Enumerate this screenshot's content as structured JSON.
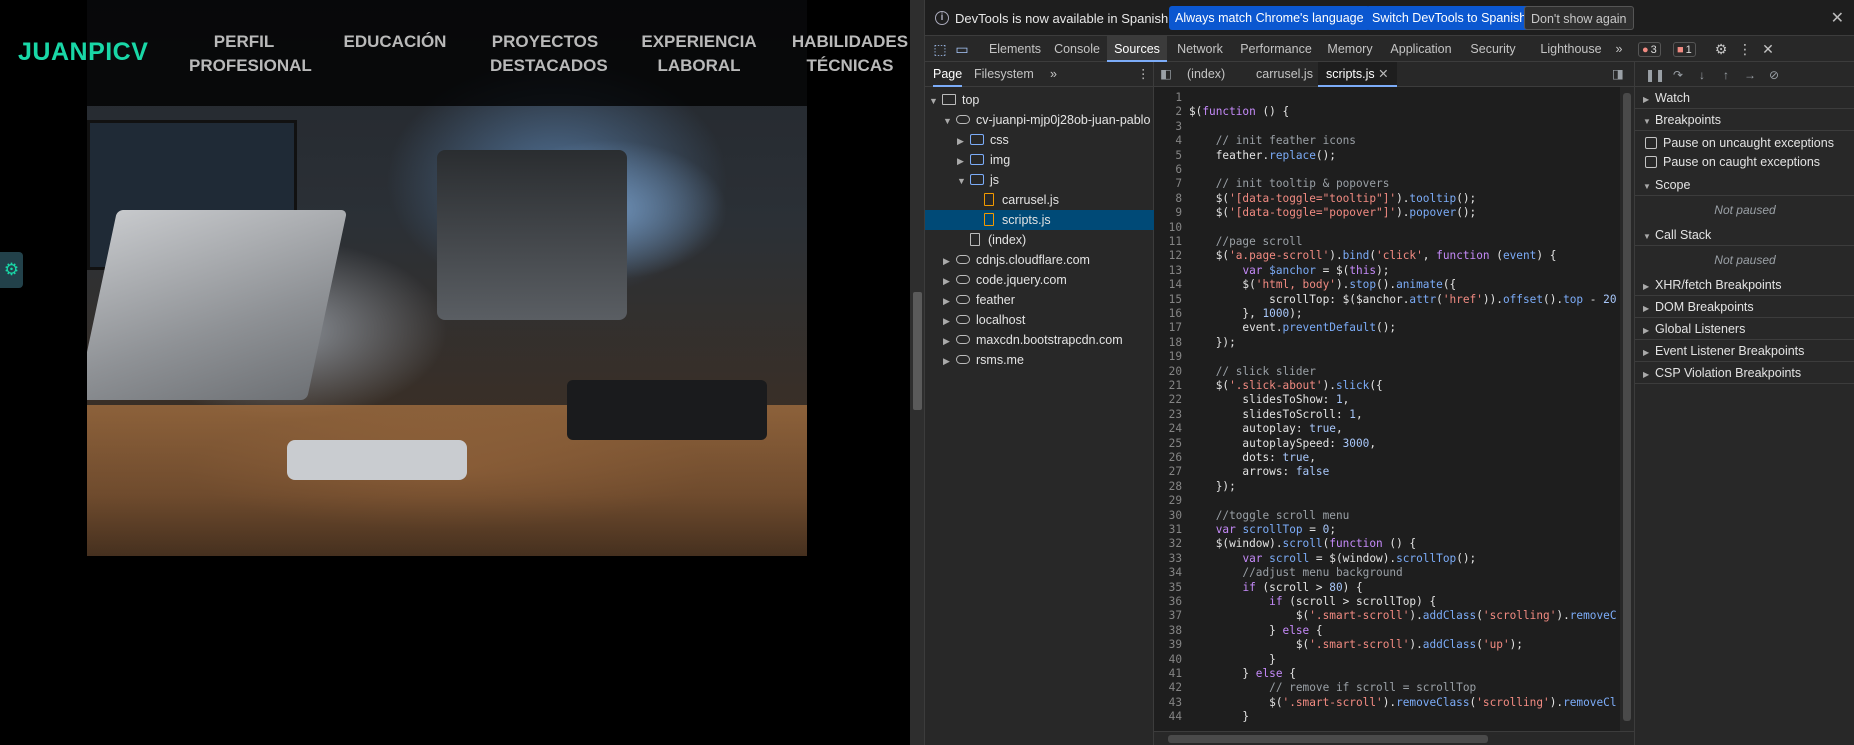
{
  "website": {
    "logo": "JUANPICV",
    "nav": [
      {
        "line1": "PERFIL",
        "line2": "PROFESIONAL"
      },
      {
        "line1": "EDUCACIÓN",
        "line2": ""
      },
      {
        "line1": "PROYECTOS",
        "line2": "DESTACADOS"
      },
      {
        "line1": "EXPERIENCIA",
        "line2": "LABORAL"
      },
      {
        "line1": "HABILIDADES",
        "line2": "TÉCNICAS"
      }
    ],
    "settings_icon": "⚙",
    "colors": {
      "accent": "#19d7a7",
      "nav_text": "#b9b9b9"
    }
  },
  "infobar": {
    "message": "DevTools is now available in Spanish!",
    "btn_match": "Always match Chrome's language",
    "btn_switch": "Switch DevTools to Spanish",
    "btn_dismiss": "Don't show again",
    "close": "✕"
  },
  "tabs": {
    "items": [
      "Elements",
      "Console",
      "Sources",
      "Network",
      "Performance",
      "Memory",
      "Application",
      "Security",
      "Lighthouse"
    ],
    "active": "Sources",
    "more": "»",
    "errors": "3",
    "warnings": "1"
  },
  "navigator": {
    "subtabs": [
      "Page",
      "Filesystem"
    ],
    "more": "»",
    "tree": [
      {
        "label": "top",
        "icon": "frame"
      },
      {
        "label": "cv-juanpi-mjp0j28ob-juan-pablo",
        "icon": "cloud"
      },
      {
        "label": "css",
        "icon": "folder"
      },
      {
        "label": "img",
        "icon": "folder"
      },
      {
        "label": "js",
        "icon": "folder"
      },
      {
        "label": "carrusel.js",
        "icon": "file-js"
      },
      {
        "label": "scripts.js",
        "icon": "file-js"
      },
      {
        "label": "(index)",
        "icon": "file"
      },
      {
        "label": "cdnjs.cloudflare.com",
        "icon": "cloud"
      },
      {
        "label": "code.jquery.com",
        "icon": "cloud"
      },
      {
        "label": "feather",
        "icon": "cloud"
      },
      {
        "label": "localhost",
        "icon": "cloud"
      },
      {
        "label": "maxcdn.bootstrapcdn.com",
        "icon": "cloud"
      },
      {
        "label": "rsms.me",
        "icon": "cloud"
      }
    ]
  },
  "editor": {
    "tabs": [
      "(index)",
      "carrusel.js",
      "scripts.js"
    ],
    "active_tab": "scripts.js",
    "lines": [
      [],
      [
        [
          "$(",
          "src"
        ],
        [
          "function",
          "c-kw"
        ],
        [
          " () {",
          "src"
        ]
      ],
      [],
      [
        [
          "    // init feather icons",
          "c-cmt"
        ]
      ],
      [
        [
          "    feather.",
          "src"
        ],
        [
          "replace",
          "c-fn"
        ],
        [
          "();",
          "src"
        ]
      ],
      [],
      [
        [
          "    // init tooltip & popovers",
          "c-cmt"
        ]
      ],
      [
        [
          "    $(",
          "src"
        ],
        [
          "'[data-toggle=\"tooltip\"]'",
          "c-str"
        ],
        [
          ").",
          "src"
        ],
        [
          "tooltip",
          "c-fn"
        ],
        [
          "();",
          "src"
        ]
      ],
      [
        [
          "    $(",
          "src"
        ],
        [
          "'[data-toggle=\"popover\"]'",
          "c-str"
        ],
        [
          ").",
          "src"
        ],
        [
          "popover",
          "c-fn"
        ],
        [
          "();",
          "src"
        ]
      ],
      [],
      [
        [
          "    //page scroll",
          "c-cmt"
        ]
      ],
      [
        [
          "    $(",
          "src"
        ],
        [
          "'a.page-scroll'",
          "c-str"
        ],
        [
          ").",
          "src"
        ],
        [
          "bind",
          "c-fn"
        ],
        [
          "(",
          "src"
        ],
        [
          "'click'",
          "c-str"
        ],
        [
          ", ",
          "src"
        ],
        [
          "function",
          "c-kw"
        ],
        [
          " (",
          "src"
        ],
        [
          "event",
          "c-var"
        ],
        [
          ") {",
          "src"
        ]
      ],
      [
        [
          "        ",
          "src"
        ],
        [
          "var",
          "c-kw"
        ],
        [
          " ",
          "src"
        ],
        [
          "$anchor",
          "c-var"
        ],
        [
          " = $(",
          "src"
        ],
        [
          "this",
          "c-kw"
        ],
        [
          ");",
          "src"
        ]
      ],
      [
        [
          "        $(",
          "src"
        ],
        [
          "'html, body'",
          "c-str"
        ],
        [
          ").",
          "src"
        ],
        [
          "stop",
          "c-fn"
        ],
        [
          "().",
          "src"
        ],
        [
          "animate",
          "c-fn"
        ],
        [
          "({",
          "src"
        ]
      ],
      [
        [
          "            scrollTop: $($anchor.",
          "src"
        ],
        [
          "attr",
          "c-fn"
        ],
        [
          "(",
          "src"
        ],
        [
          "'href'",
          "c-str"
        ],
        [
          ")).",
          "src"
        ],
        [
          "offset",
          "c-fn"
        ],
        [
          "().",
          "src"
        ],
        [
          "top",
          "c-var"
        ],
        [
          " - ",
          "src"
        ],
        [
          "20",
          "c-num"
        ]
      ],
      [
        [
          "        }, ",
          "src"
        ],
        [
          "1000",
          "c-num"
        ],
        [
          ");",
          "src"
        ]
      ],
      [
        [
          "        event.",
          "src"
        ],
        [
          "preventDefault",
          "c-fn"
        ],
        [
          "();",
          "src"
        ]
      ],
      [
        [
          "    });",
          "src"
        ]
      ],
      [],
      [
        [
          "    // slick slider",
          "c-cmt"
        ]
      ],
      [
        [
          "    $(",
          "src"
        ],
        [
          "'.slick-about'",
          "c-str"
        ],
        [
          ").",
          "src"
        ],
        [
          "slick",
          "c-fn"
        ],
        [
          "({",
          "src"
        ]
      ],
      [
        [
          "        slidesToShow: ",
          "src"
        ],
        [
          "1",
          "c-num"
        ],
        [
          ",",
          "src"
        ]
      ],
      [
        [
          "        slidesToScroll: ",
          "src"
        ],
        [
          "1",
          "c-num"
        ],
        [
          ",",
          "src"
        ]
      ],
      [
        [
          "        autoplay: ",
          "src"
        ],
        [
          "true",
          "c-lit"
        ],
        [
          ",",
          "src"
        ]
      ],
      [
        [
          "        autoplaySpeed: ",
          "src"
        ],
        [
          "3000",
          "c-num"
        ],
        [
          ",",
          "src"
        ]
      ],
      [
        [
          "        dots: ",
          "src"
        ],
        [
          "true",
          "c-lit"
        ],
        [
          ",",
          "src"
        ]
      ],
      [
        [
          "        arrows: ",
          "src"
        ],
        [
          "false",
          "c-lit"
        ]
      ],
      [
        [
          "    });",
          "src"
        ]
      ],
      [],
      [
        [
          "    //toggle scroll menu",
          "c-cmt"
        ]
      ],
      [
        [
          "    ",
          "src"
        ],
        [
          "var",
          "c-kw"
        ],
        [
          " ",
          "src"
        ],
        [
          "scrollTop",
          "c-var"
        ],
        [
          " = ",
          "src"
        ],
        [
          "0",
          "c-num"
        ],
        [
          ";",
          "src"
        ]
      ],
      [
        [
          "    $(window).",
          "src"
        ],
        [
          "scroll",
          "c-fn"
        ],
        [
          "(",
          "src"
        ],
        [
          "function",
          "c-kw"
        ],
        [
          " () {",
          "src"
        ]
      ],
      [
        [
          "        ",
          "src"
        ],
        [
          "var",
          "c-kw"
        ],
        [
          " ",
          "src"
        ],
        [
          "scroll",
          "c-var"
        ],
        [
          " = $(window).",
          "src"
        ],
        [
          "scrollTop",
          "c-fn"
        ],
        [
          "();",
          "src"
        ]
      ],
      [
        [
          "        //adjust menu background",
          "c-cmt"
        ]
      ],
      [
        [
          "        ",
          "src"
        ],
        [
          "if",
          "c-kw"
        ],
        [
          " (scroll > ",
          "src"
        ],
        [
          "80",
          "c-num"
        ],
        [
          ") {",
          "src"
        ]
      ],
      [
        [
          "            ",
          "src"
        ],
        [
          "if",
          "c-kw"
        ],
        [
          " (scroll > scrollTop) {",
          "src"
        ]
      ],
      [
        [
          "                $(",
          "src"
        ],
        [
          "'.smart-scroll'",
          "c-str"
        ],
        [
          ").",
          "src"
        ],
        [
          "addClass",
          "c-fn"
        ],
        [
          "(",
          "src"
        ],
        [
          "'scrolling'",
          "c-str"
        ],
        [
          ").",
          "src"
        ],
        [
          "removeC",
          "c-fn"
        ]
      ],
      [
        [
          "            } ",
          "src"
        ],
        [
          "else",
          "c-kw"
        ],
        [
          " {",
          "src"
        ]
      ],
      [
        [
          "                $(",
          "src"
        ],
        [
          "'.smart-scroll'",
          "c-str"
        ],
        [
          ").",
          "src"
        ],
        [
          "addClass",
          "c-fn"
        ],
        [
          "(",
          "src"
        ],
        [
          "'up'",
          "c-str"
        ],
        [
          ");",
          "src"
        ]
      ],
      [
        [
          "            }",
          "src"
        ]
      ],
      [
        [
          "        } ",
          "src"
        ],
        [
          "else",
          "c-kw"
        ],
        [
          " {",
          "src"
        ]
      ],
      [
        [
          "            // remove if scroll = scrollTop",
          "c-cmt"
        ]
      ],
      [
        [
          "            $(",
          "src"
        ],
        [
          "'.smart-scroll'",
          "c-str"
        ],
        [
          ").",
          "src"
        ],
        [
          "removeClass",
          "c-fn"
        ],
        [
          "(",
          "src"
        ],
        [
          "'scrolling'",
          "c-str"
        ],
        [
          ").",
          "src"
        ],
        [
          "removeCl",
          "c-fn"
        ]
      ],
      [
        [
          "        }",
          "src"
        ]
      ]
    ]
  },
  "debugger": {
    "sections": {
      "watch": "Watch",
      "breakpoints": "Breakpoints",
      "pause_uncaught": "Pause on uncaught exceptions",
      "pause_caught": "Pause on caught exceptions",
      "scope": "Scope",
      "scope_status": "Not paused",
      "callstack": "Call Stack",
      "callstack_status": "Not paused",
      "xhr": "XHR/fetch Breakpoints",
      "dom": "DOM Breakpoints",
      "global": "Global Listeners",
      "event": "Event Listener Breakpoints",
      "csp": "CSP Violation Breakpoints"
    }
  }
}
